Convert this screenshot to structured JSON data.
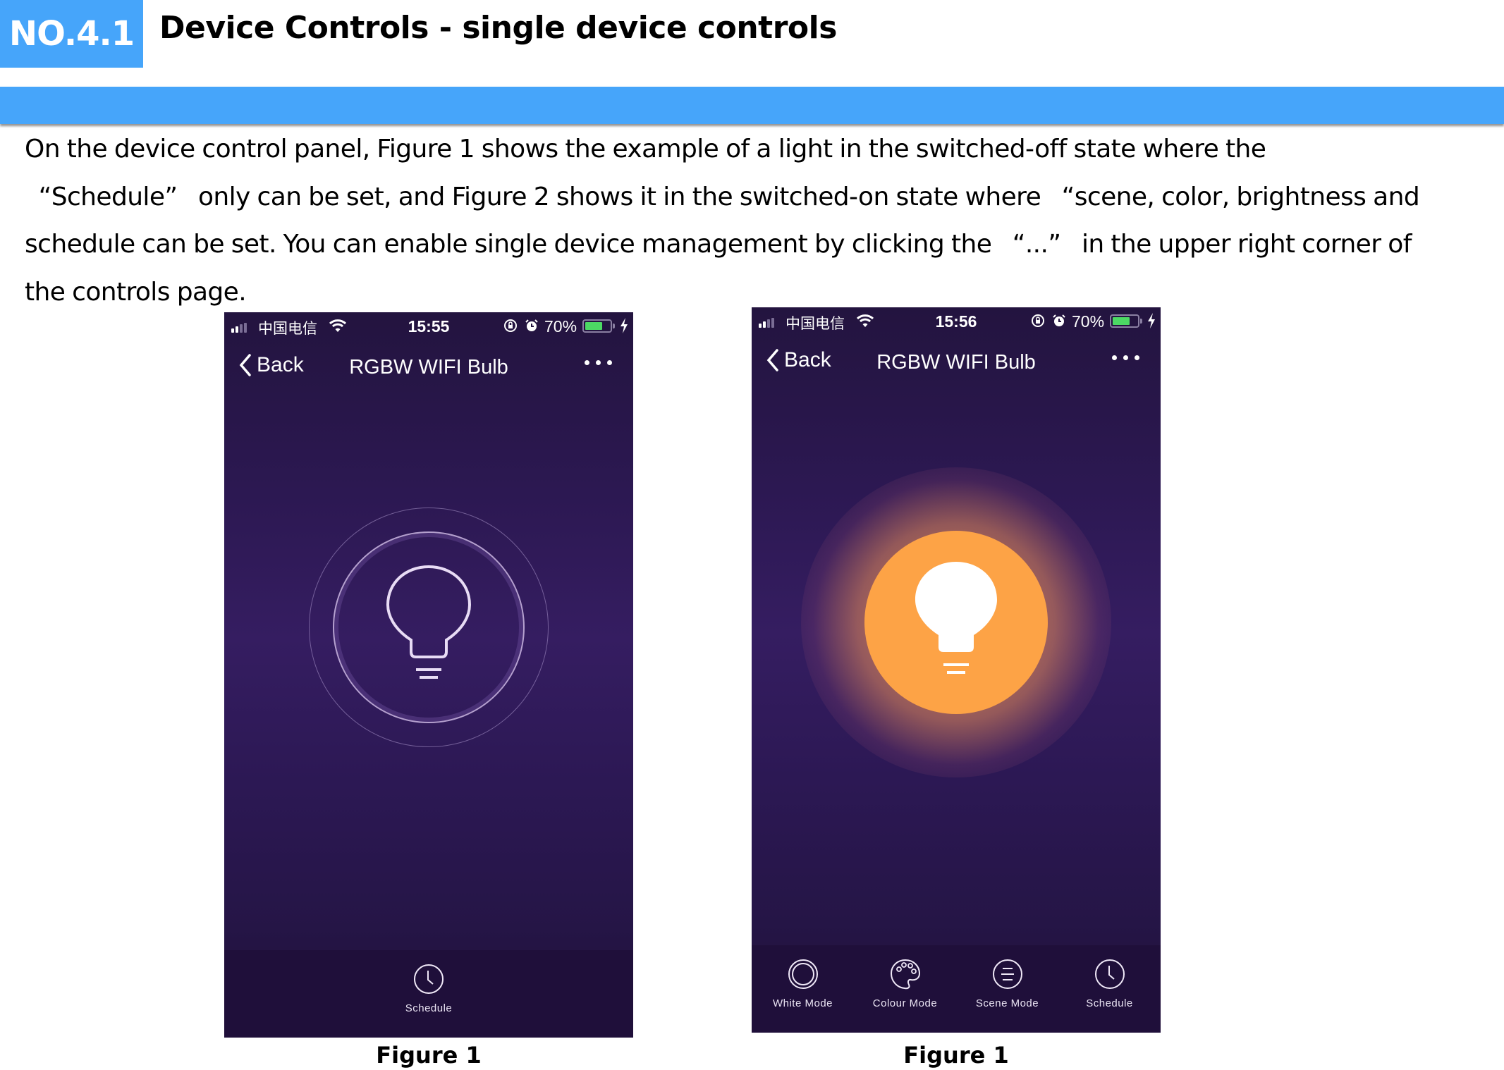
{
  "section": {
    "number": "NO.4.1",
    "title": "Device Controls - single device controls",
    "accent_color": "#46a5fa"
  },
  "body_text": "On the device control panel, Figure 1 shows the example of a light in the switched-off state where the “Schedule” only can be set, and Figure 2 shows it in the switched-on state where “scene, color, brightness and schedule can be set. You can enable single device management by clicking the “...” in the upper right corner of the controls page.",
  "body_lines": [
    "On the device control panel, Figure 1 shows the example of a light in the switched-off state where the",
    "  “Schedule”   only can be set, and Figure 2 shows it in the switched-on state where   “scene, color, brightness and",
    "schedule can be set. You can enable single device management by clicking the   “...”   in the upper right corner of",
    "the controls page."
  ],
  "figures": [
    {
      "caption": "Figure 1",
      "state": "off",
      "status_bar": {
        "carrier": "中国电信",
        "time": "15:55",
        "battery_percent": "70%",
        "battery_level": 0.7
      },
      "nav": {
        "back_label": "Back",
        "title": "RGBW WIFI Bulb",
        "more_icon": "ellipsis-icon"
      },
      "bulb": {
        "icon": "lightbulb-outline-icon",
        "on": false
      },
      "tabs": [
        {
          "label": "Schedule",
          "icon": "clock-icon"
        }
      ]
    },
    {
      "caption": "Figure 1",
      "state": "on",
      "status_bar": {
        "carrier": "中国电信",
        "time": "15:56",
        "battery_percent": "70%",
        "battery_level": 0.7
      },
      "nav": {
        "back_label": "Back",
        "title": "RGBW WIFI Bulb",
        "more_icon": "ellipsis-icon"
      },
      "bulb": {
        "icon": "lightbulb-filled-icon",
        "on": true,
        "color": "#fda346"
      },
      "tabs": [
        {
          "label": "White Mode",
          "icon": "ring-icon"
        },
        {
          "label": "Colour Mode",
          "icon": "palette-icon"
        },
        {
          "label": "Scene Mode",
          "icon": "list-icon"
        },
        {
          "label": "Schedule",
          "icon": "clock-icon"
        }
      ]
    }
  ]
}
